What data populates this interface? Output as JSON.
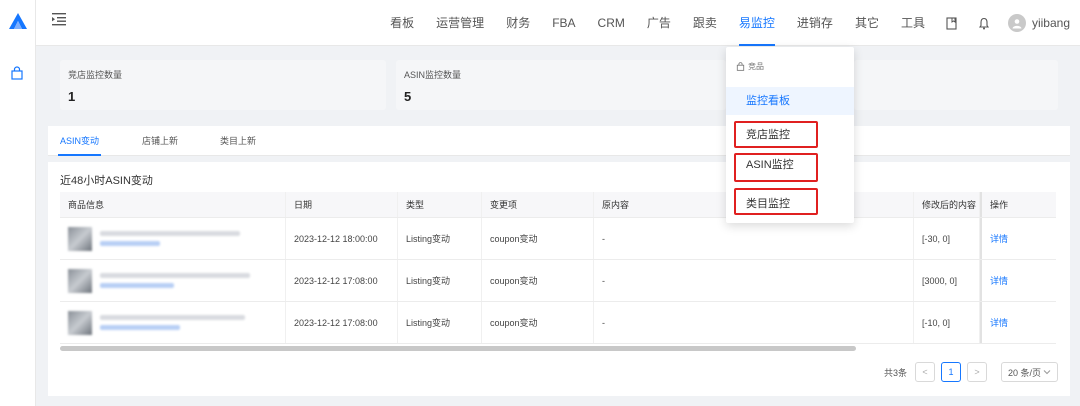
{
  "nav": {
    "items": [
      "看板",
      "运营管理",
      "财务",
      "FBA",
      "CRM",
      "广告",
      "跟卖",
      "易监控",
      "进销存",
      "其它",
      "工具"
    ],
    "active": "易监控",
    "user": "yiibang"
  },
  "stats": [
    {
      "label": "竞店监控数量",
      "value": "1"
    },
    {
      "label": "ASIN监控数量",
      "value": "5"
    }
  ],
  "tabs": [
    "ASIN变动",
    "店铺上新",
    "类目上新"
  ],
  "panel_title": "近48小时ASIN变动",
  "table": {
    "headers": [
      "商品信息",
      "日期",
      "类型",
      "变更项",
      "原内容",
      "修改后的内容",
      "操作"
    ],
    "rows": [
      {
        "date": "2023-12-12 18:00:00",
        "type": "Listing变动",
        "change": "coupon变动",
        "original": "-",
        "modified": "[-30, 0]",
        "action": "详情"
      },
      {
        "date": "2023-12-12 17:08:00",
        "type": "Listing变动",
        "change": "coupon变动",
        "original": "-",
        "modified": "[3000, 0]",
        "action": "详情"
      },
      {
        "date": "2023-12-12 17:08:00",
        "type": "Listing变动",
        "change": "coupon变动",
        "original": "-",
        "modified": "[-10, 0]",
        "action": "详情"
      }
    ]
  },
  "pagination": {
    "total": "共3条",
    "current": "1",
    "prev": "<",
    "next": ">",
    "page_size": "20 条/页"
  },
  "dropdown": {
    "group": "竞品",
    "items": [
      "监控看板",
      "竞店监控",
      "ASIN监控",
      "类目监控"
    ],
    "selected": "监控看板"
  },
  "colors": {
    "accent": "#1677ff",
    "highlight_box": "#e02020"
  }
}
